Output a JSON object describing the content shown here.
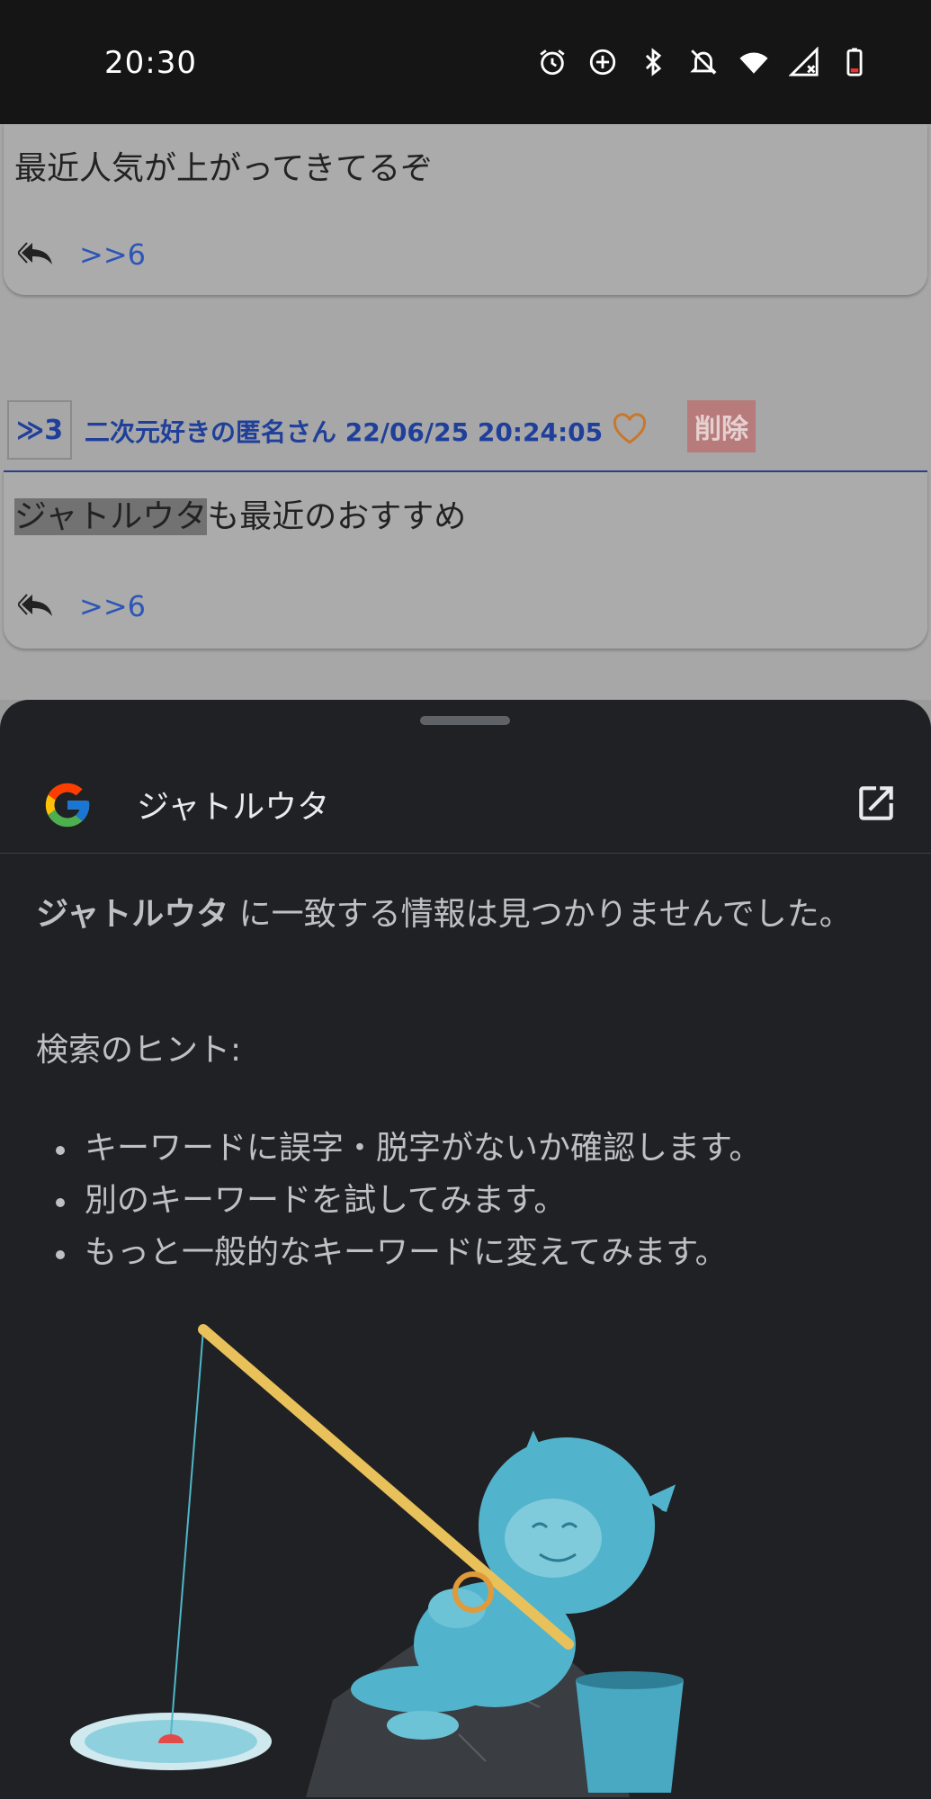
{
  "status_bar": {
    "time": "20:30",
    "icons": [
      "alarm-icon",
      "data-saver-icon",
      "bluetooth-icon",
      "bell-off-icon",
      "wifi-icon",
      "signal-off-icon",
      "battery-icon"
    ]
  },
  "thread": {
    "post1": {
      "text": "最近人気が上がってきてるぞ",
      "reply_link": ">>6"
    },
    "post2": {
      "number": "≫3",
      "poster": "二次元好きの匿名さん 22/06/25 20:24:05",
      "delete_label": "削除",
      "text_highlight": "ジャトルウタ",
      "text_rest": "も最近のおすすめ",
      "reply_link": ">>6"
    }
  },
  "sheet": {
    "query": "ジャトルウタ",
    "result_bold": "ジャトルウタ",
    "result_rest": " に一致する情報は見つかりませんでした。",
    "tips_title": "検索のヒント:",
    "tips": [
      "キーワードに誤字・脱字がないか確認します。",
      "別のキーワードを試してみます。",
      "もっと一般的なキーワードに変えてみます。"
    ]
  },
  "colors": {
    "sheet_bg": "#202124",
    "link_blue": "#2d56b8",
    "poster_blue": "#1f3f9a",
    "heart_orange": "#c9772a"
  }
}
